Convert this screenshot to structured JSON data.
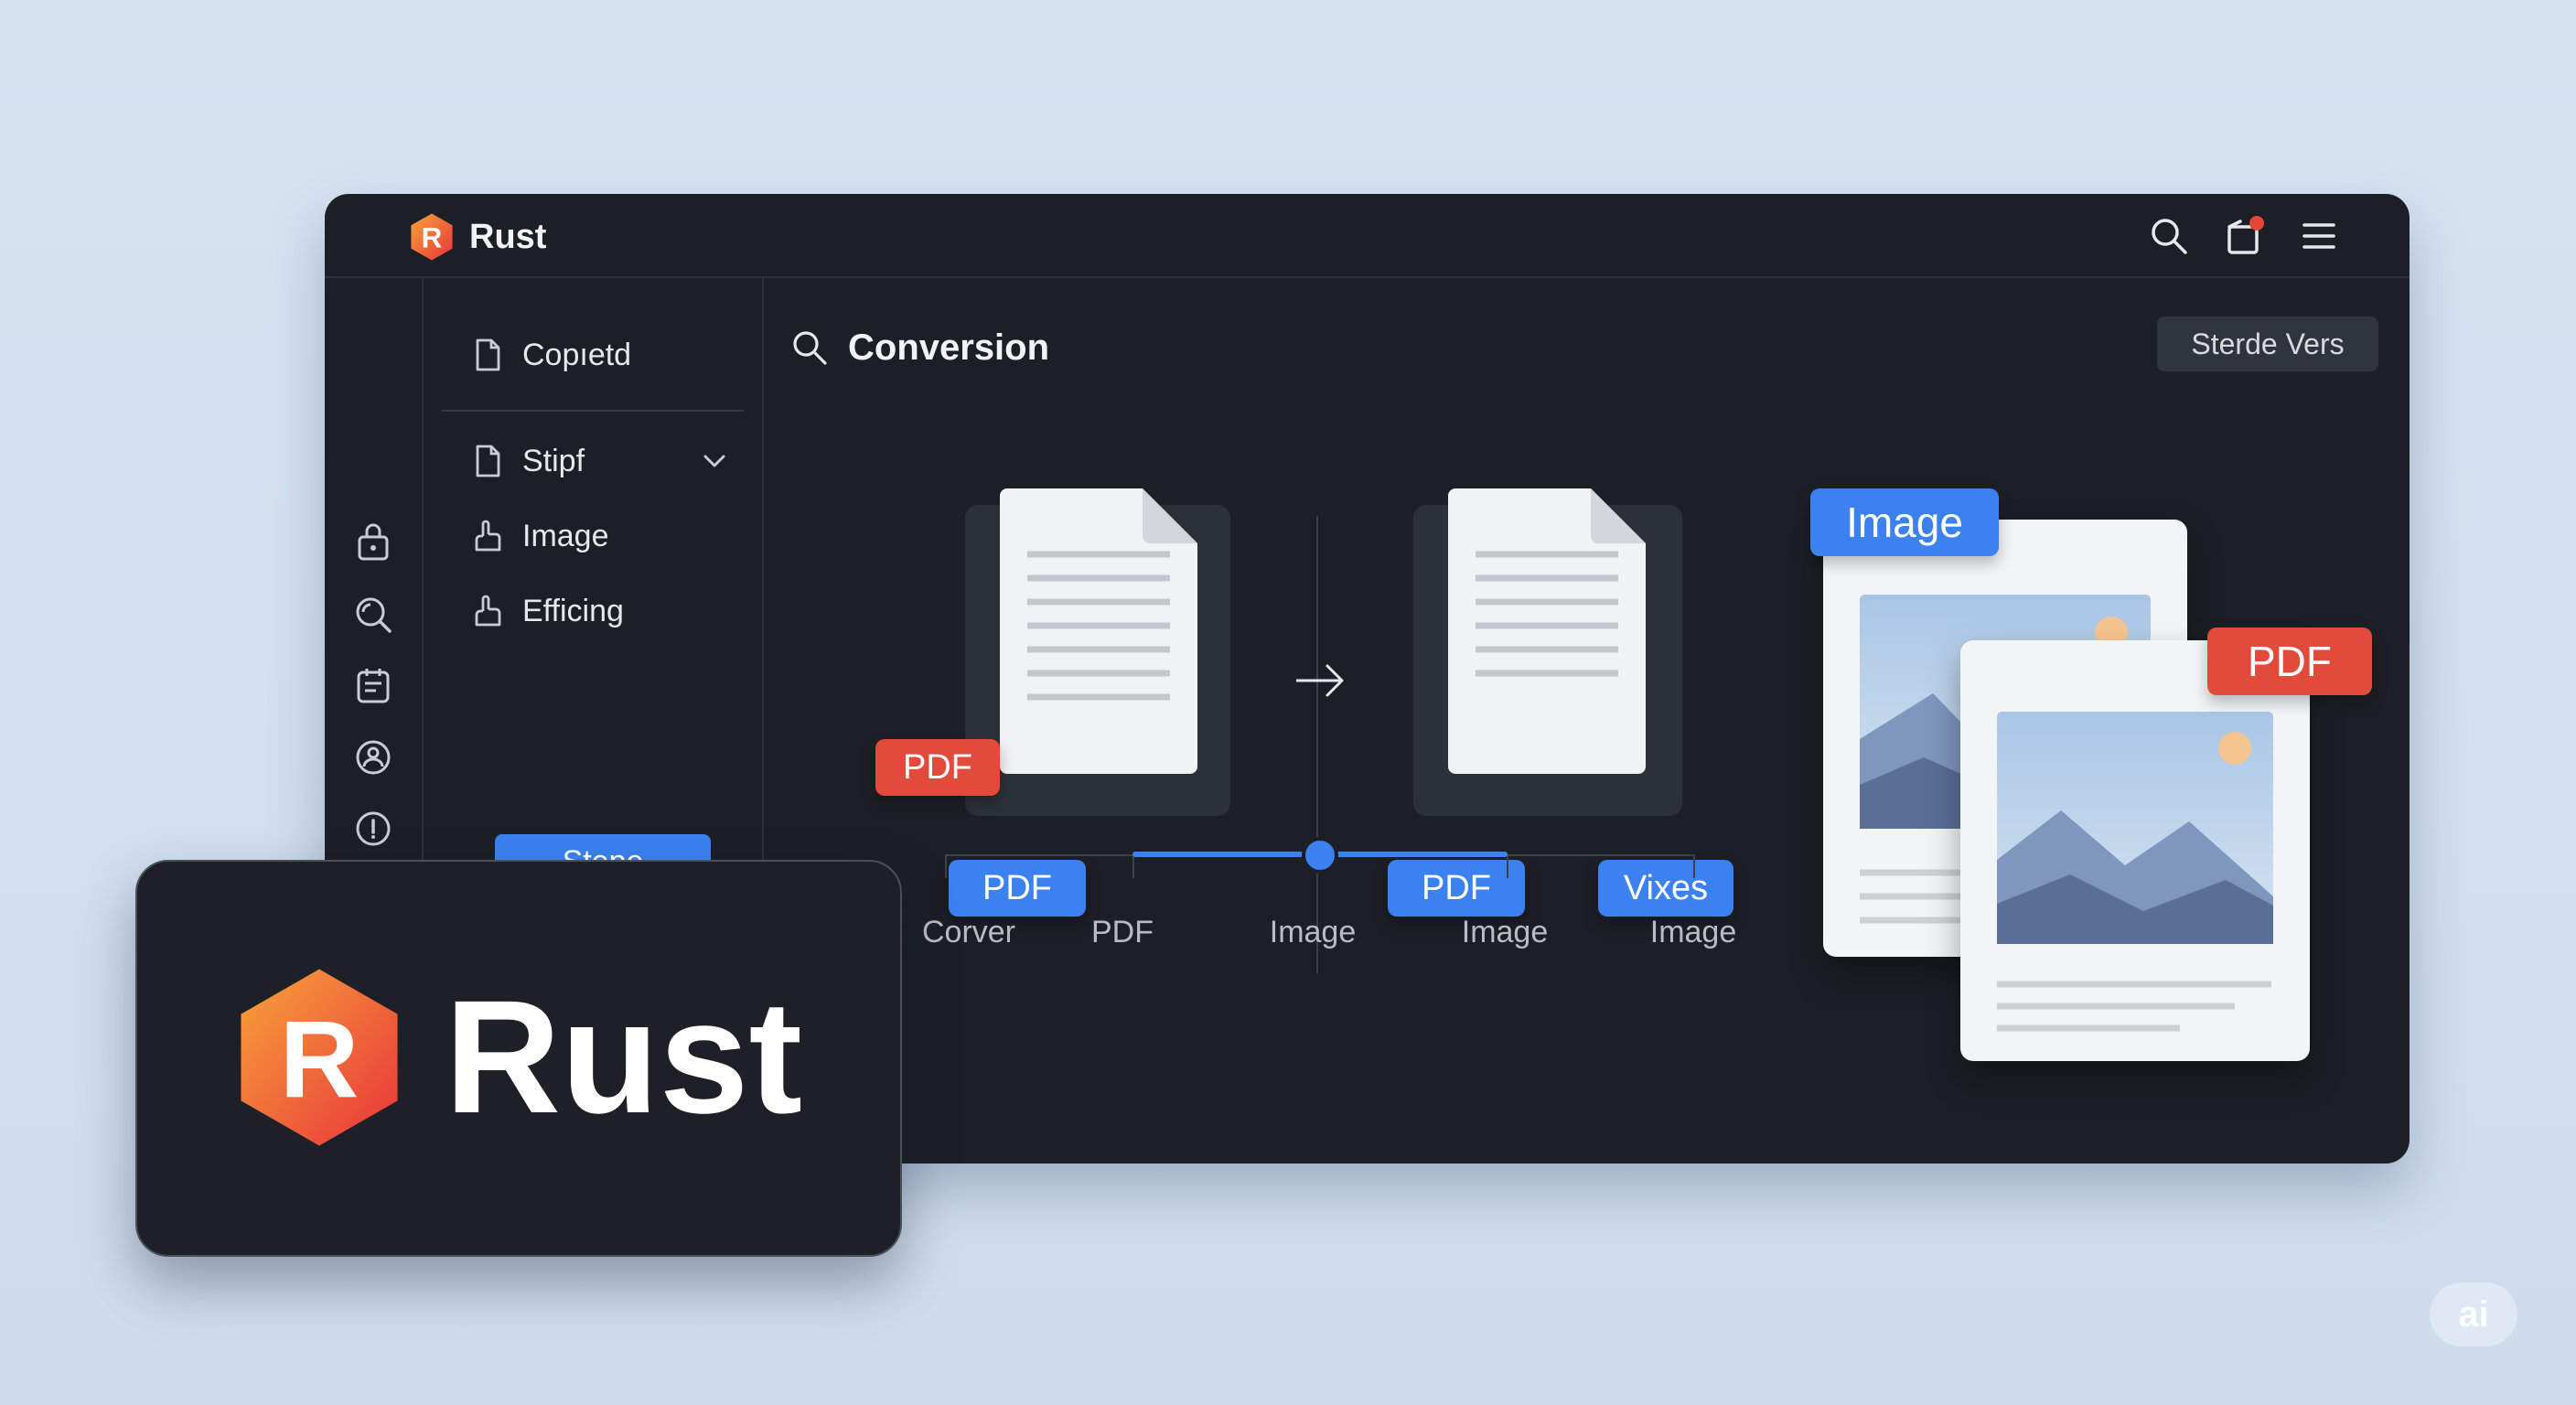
{
  "app": {
    "title": "Rust",
    "logo_letter": "R"
  },
  "titlebar": {
    "icons": [
      "search-icon",
      "notification-icon",
      "menu-icon"
    ],
    "notification_dot_color": "#e5463a"
  },
  "rail": {
    "icons": [
      "lock-icon",
      "magnify-icon",
      "calendar-icon",
      "account-icon",
      "info-icon"
    ]
  },
  "side": {
    "items": [
      {
        "label": "Copıetd",
        "icon": "file-icon"
      },
      {
        "label": "Stipf",
        "icon": "file-icon"
      },
      {
        "label": "Image",
        "icon": "hand-icon"
      },
      {
        "label": "Efficing",
        "icon": "hand-icon"
      }
    ],
    "button": "Stepe"
  },
  "content": {
    "title": "Conversion",
    "header_button": "Sterde Vers",
    "doc1": {
      "tag_top": "PDF",
      "tag_bottom": "PDF"
    },
    "doc2": {
      "tag_left": "PDF",
      "tag_right": "Vixes"
    },
    "image_card_back_tag": "Image",
    "image_card_front_tag": "PDF",
    "timeline": {
      "labels": [
        "Corver",
        "PDF",
        "Image",
        "Image",
        "Image"
      ],
      "progress_start": 0.25,
      "progress_knob": 0.5,
      "progress_end": 0.75
    }
  },
  "brand_card": {
    "logo_letter": "R",
    "name": "Rust"
  },
  "watermark": "ai",
  "colors": {
    "accent_blue": "#3b82f0",
    "accent_red": "#e24b3c",
    "window_bg": "#1c1f25",
    "page_bg": "#d6e3f1"
  }
}
